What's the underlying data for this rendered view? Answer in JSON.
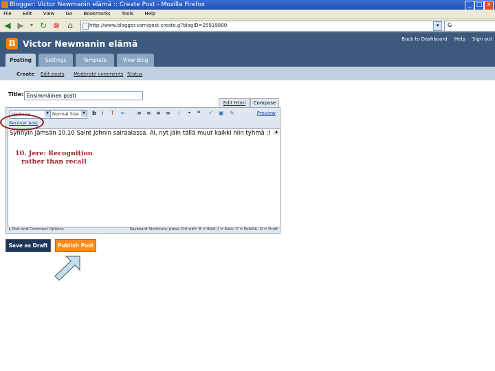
{
  "window": {
    "title": "Blogger: Victor Newmanin elämä :: Create Post - Mozilla Firefox",
    "controls": [
      "_",
      "□",
      "×"
    ]
  },
  "menu": [
    "File",
    "Edit",
    "View",
    "Go",
    "Bookmarks",
    "Tools",
    "Help"
  ],
  "nav": {
    "url": "http://www.blogger.com/post-create.g?blogID=25919880",
    "search_value": "G"
  },
  "header": {
    "logo_letter": "B",
    "blog_title": "Victor Newmanin elämä",
    "links": [
      "Back to Dashboard",
      "Help",
      "Sign out"
    ],
    "tabs": [
      "Posting",
      "Settings",
      "Template",
      "View Blog"
    ]
  },
  "subnav": [
    "Create",
    "Edit posts",
    "Moderate comments",
    "Status"
  ],
  "form": {
    "title_label": "Title:",
    "title_value": "Ensimmäinen posti",
    "mode_tabs": [
      "Edit Html",
      "Compose"
    ],
    "font_select": "Verdana",
    "size_select": "Normal Size",
    "preview_link": "Preview",
    "recover_link": "Recover post",
    "body_text": "Synnyin Jämsän 10.10 Saint Johnin sairaalassa. Ai, nyt jäin tällä muut kaikki niin tyhmä :)",
    "post_options": "▸ Post and Comment Options",
    "shortcuts": "Keyboard Shortcuts: press Ctrl with: B = Bold, I = Italic, P = Publish, D = Draft",
    "buttons": {
      "save_draft": "Save as Draft",
      "publish": "Publish Post"
    }
  },
  "annotation": {
    "line1": "10. Jere: Recognition",
    "line2": "rather than recall"
  },
  "colors": {
    "header_bg": "#3d5a7e",
    "subnav_bg": "#c0d2e1",
    "publish_bg": "#ff8a1c",
    "annotation": "#a0202a"
  }
}
